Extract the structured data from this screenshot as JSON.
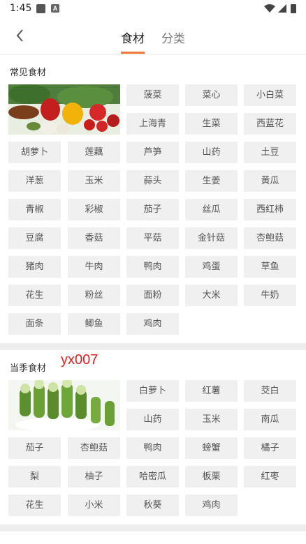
{
  "status": {
    "time": "1:45",
    "notif_letter": "A"
  },
  "header": {
    "tabs": [
      "食材",
      "分类"
    ]
  },
  "watermark": "yx007",
  "sections": [
    {
      "title": "常见食材",
      "items": [
        "菠菜",
        "菜心",
        "小白菜",
        "上海青",
        "生菜",
        "西蓝花",
        "胡萝卜",
        "莲藕",
        "芦笋",
        "山药",
        "土豆",
        "洋葱",
        "玉米",
        "蒜头",
        "生姜",
        "黄瓜",
        "青椒",
        "彩椒",
        "茄子",
        "丝瓜",
        "西红柿",
        "豆腐",
        "香菇",
        "平菇",
        "金针菇",
        "杏鲍菇",
        "猪肉",
        "牛肉",
        "鸭肉",
        "鸡蛋",
        "草鱼",
        "花生",
        "粉丝",
        "面粉",
        "大米",
        "牛奶",
        "面条",
        "鲫鱼",
        "鸡肉"
      ]
    },
    {
      "title": "当季食材",
      "items": [
        "白萝卜",
        "红薯",
        "茭白",
        "山药",
        "玉米",
        "南瓜",
        "茄子",
        "杏鲍菇",
        "鸭肉",
        "螃蟹",
        "橘子",
        "梨",
        "柚子",
        "哈密瓜",
        "板栗",
        "红枣",
        "花生",
        "小米",
        "秋葵",
        "鸡肉"
      ]
    }
  ],
  "colors": {
    "accent": "#f1763a",
    "chip_bg": "#f0f0f0",
    "watermark": "#e02020"
  }
}
